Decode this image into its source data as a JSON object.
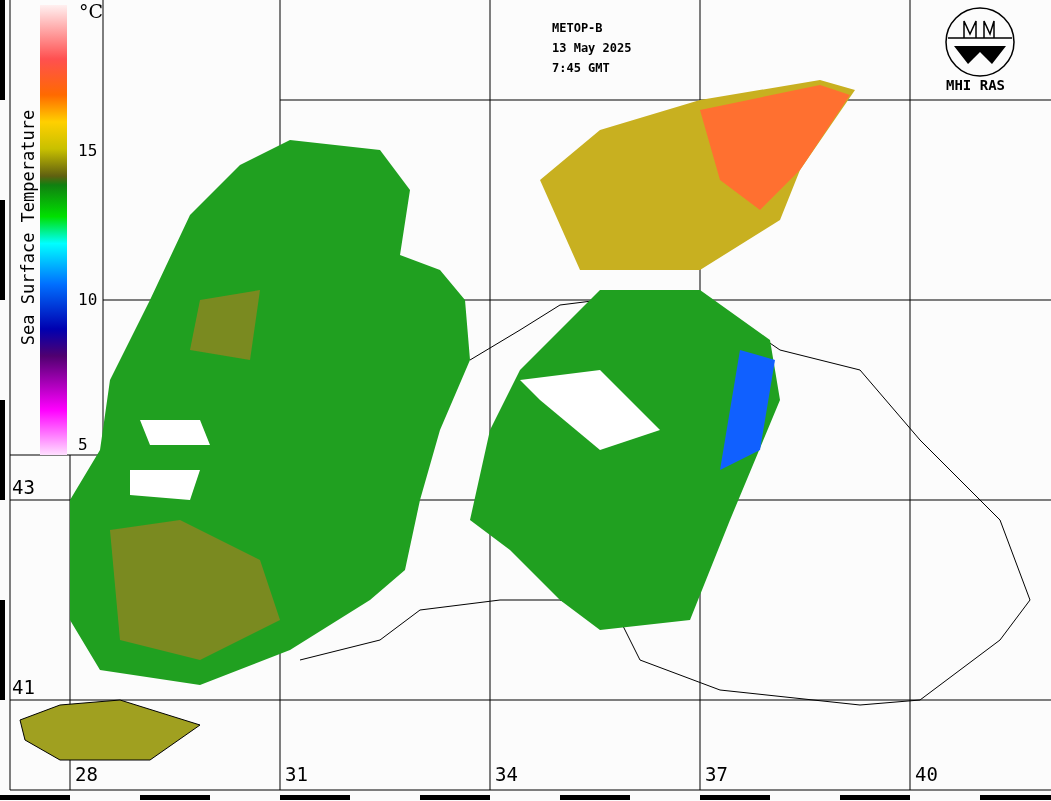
{
  "header": {
    "lines": [
      "METOP-B",
      "13 May 2025",
      "7:45 GMT"
    ]
  },
  "legend": {
    "title": "Sea Surface Temperature",
    "unit": "°C",
    "ticks": [
      "15",
      "10",
      "5"
    ]
  },
  "latitude_labels": [
    "43",
    "41"
  ],
  "longitude_labels": [
    "28",
    "31",
    "34",
    "37",
    "40"
  ],
  "logo": {
    "text": "MHI RAS"
  }
}
